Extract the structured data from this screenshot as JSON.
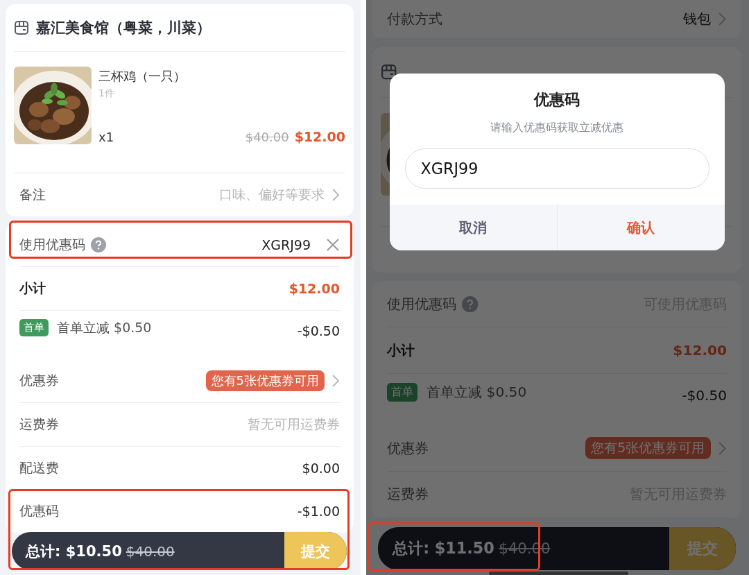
{
  "left": {
    "store": {
      "name": "嘉汇美食馆（粤菜，川菜）",
      "item": {
        "kind": "picture",
        "name": "三杯鸡（一只）",
        "count": "1件",
        "qty": "x1",
        "original_price": "$40.00",
        "price": "$12.00"
      },
      "remark": {
        "label": "备注",
        "placeholder": "口味、偏好等要求"
      }
    },
    "summary": [
      {
        "kind": "code",
        "label": "使用优惠码",
        "value": "XGRJ99",
        "highlighted": true
      },
      {
        "kind": "subtotal",
        "label": "小计",
        "value": "$12.00"
      },
      {
        "kind": "discount",
        "tag": "首单",
        "label": "首单立减 $0.50",
        "value": "-$0.50"
      },
      {
        "kind": "coupon",
        "label": "优惠券",
        "badge": "您有5张优惠券可用"
      },
      {
        "kind": "muted",
        "label": "运费券",
        "hint": "暂无可用运费券"
      },
      {
        "kind": "plain",
        "label": "配送费",
        "value": "$0.00"
      },
      {
        "kind": "plain",
        "label": "优惠码",
        "value": "-$1.00"
      }
    ],
    "bottom_bar": {
      "total": "总计: $10.50",
      "original_total": "$40.00",
      "submit": "提交",
      "highlighted": true
    }
  },
  "right": {
    "payment": {
      "label": "付款方式",
      "value": "钱包"
    },
    "summary": [
      {
        "kind": "code",
        "label": "使用优惠码",
        "placeholder": "可使用优惠码"
      },
      {
        "kind": "subtotal",
        "label": "小计",
        "value": "$12.00"
      },
      {
        "kind": "discount",
        "tag": "首单",
        "label": "首单立减 $0.50",
        "value": "-$0.50"
      },
      {
        "kind": "coupon",
        "label": "优惠券",
        "badge": "您有5张优惠券可用"
      },
      {
        "kind": "muted",
        "label": "运费券",
        "hint": "暂无可用运费券"
      }
    ],
    "bottom_bar": {
      "total": "总计: $11.50",
      "original_total": "$40.00",
      "submit": "提交",
      "highlighted": true
    },
    "dialog": {
      "title": "优惠码",
      "subtitle": "请输入优惠码获取立减优惠",
      "input": {
        "value": "XGRJ99"
      },
      "buttons": [
        {
          "label": "取消",
          "kind": "cancel"
        },
        {
          "label": "确认",
          "kind": "confirm"
        }
      ]
    }
  }
}
